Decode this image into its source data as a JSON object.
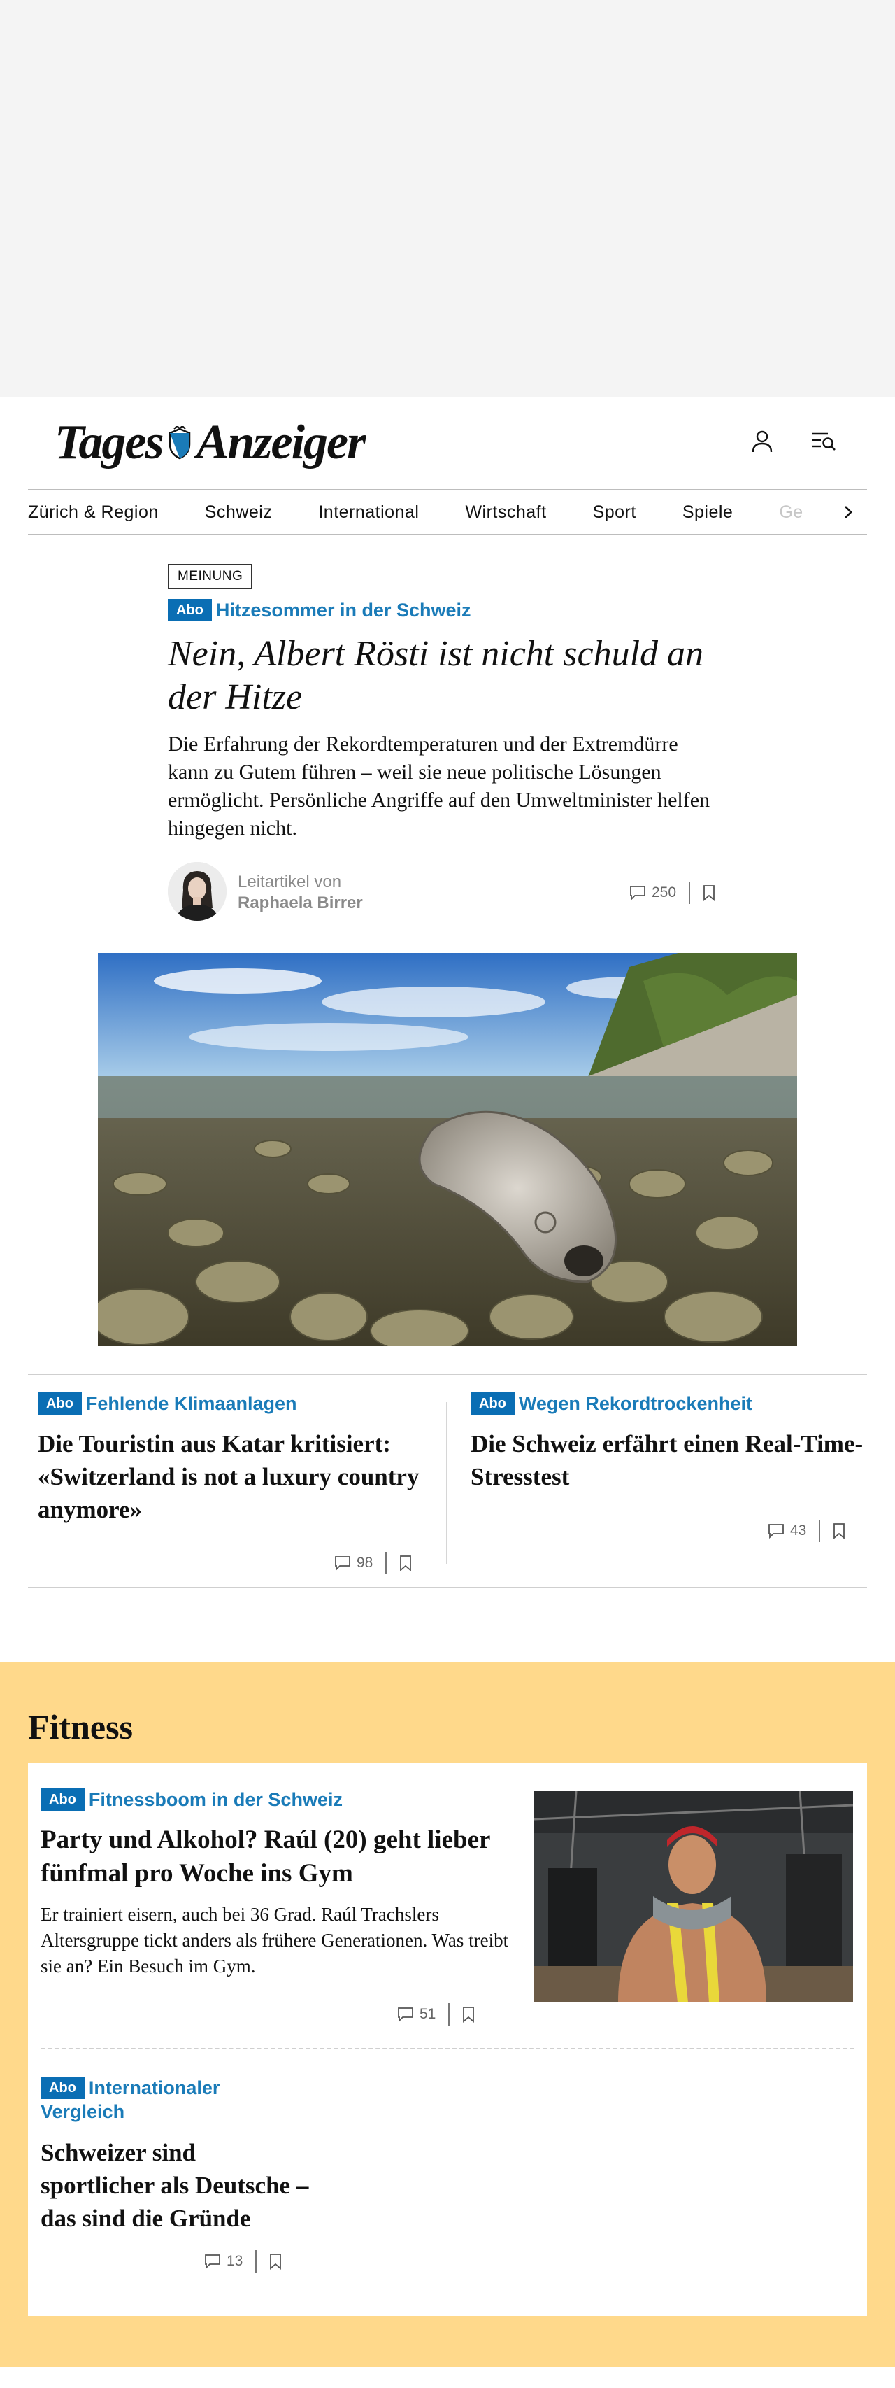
{
  "brand": {
    "name_left": "Tages",
    "name_right": "Anzeiger"
  },
  "header": {
    "account_icon": "user-icon",
    "menu_search_icon": "menu-search-icon"
  },
  "nav": {
    "items": [
      "Zürich & Region",
      "Schweiz",
      "International",
      "Wirtschaft",
      "Sport",
      "Spiele",
      "Ge"
    ],
    "next_icon": "chevron-right-icon"
  },
  "lead": {
    "section_label": "MEINUNG",
    "abo": "Abo",
    "kicker": "Hitzesommer in der Schweiz",
    "title": "Nein, Albert Rösti ist nicht schuld an der Hitze",
    "subtitle": "Die Erfahrung der Rekordtemperaturen und der Extremdürre kann zu Gutem führen – weil sie neue politische Lösungen ermöglicht. Persönliche Angriffe auf den Umweltminister helfen hingegen nicht.",
    "byline_prefix": "Leitartikel von",
    "author": "Raphaela Birrer",
    "comments": "250"
  },
  "teasers": [
    {
      "abo": "Abo",
      "kicker": "Fehlende Klimaanlagen",
      "title": "Die Touristin aus Katar kritisiert: «Switzerland is not a luxury country anymore»",
      "comments": "98"
    },
    {
      "abo": "Abo",
      "kicker": "Wegen Rekordtrockenheit",
      "title": "Die Schweiz erfährt einen Real-Time-Stresstest",
      "comments": "43"
    }
  ],
  "fitness": {
    "heading": "Fitness",
    "main": {
      "abo": "Abo",
      "kicker": "Fitnessboom in der Schweiz",
      "title": "Party und Alkohol? Raúl (20) geht lieber fünfmal pro Woche ins Gym",
      "subtitle": "Er trainiert eisern, auch bei 36 Grad. Raúl Trachslers Altersgruppe tickt anders als frühere Generationen. Was treibt sie an? Ein Besuch im Gym.",
      "comments": "51"
    },
    "second": {
      "abo": "Abo",
      "kicker_line1": "Internationaler",
      "kicker_line2": "Vergleich",
      "title": "Schweizer sind sportlicher als Deutsche – das sind die Gründe",
      "comments": "13"
    }
  },
  "colors": {
    "accent_blue": "#0a6eb4",
    "kicker_blue": "#1a7bb8",
    "fitness_bg": "#ffd98b",
    "ad_bg": "#f4f4f4"
  }
}
